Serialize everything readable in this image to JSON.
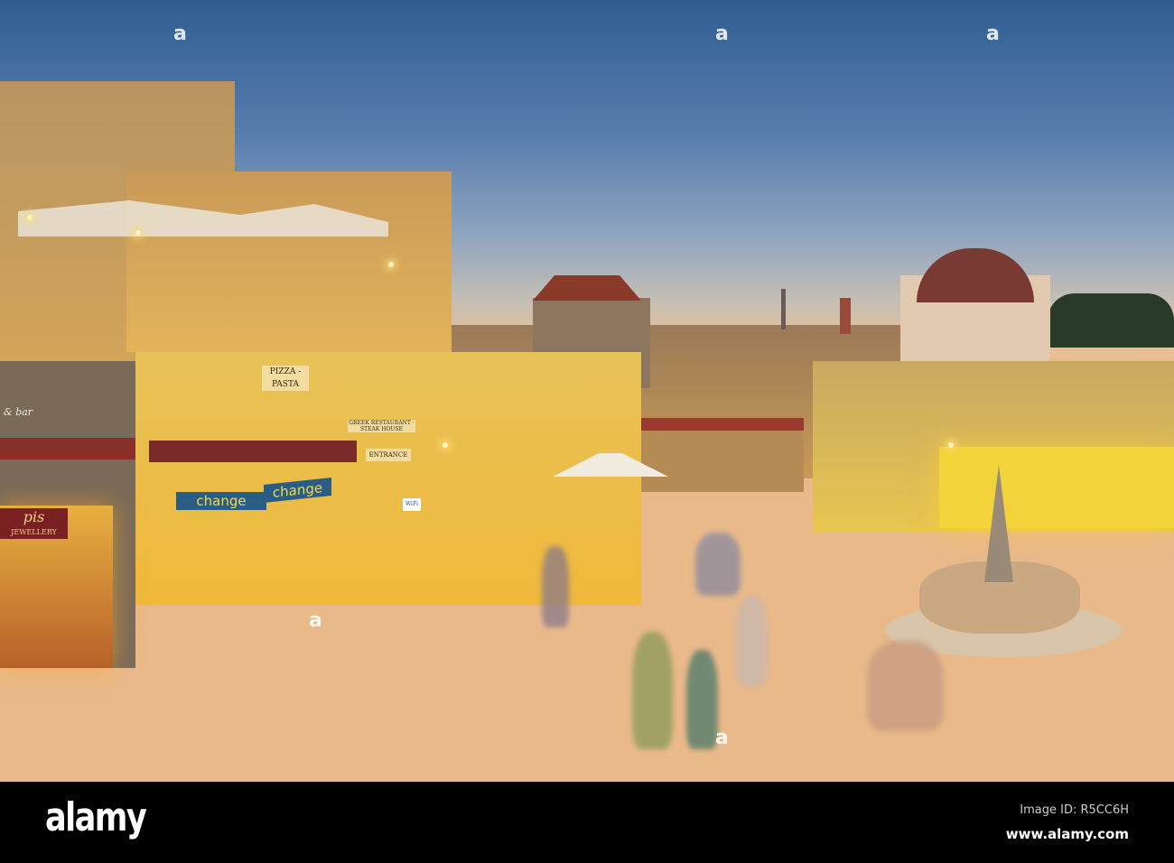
{
  "photo": {
    "signs": {
      "pizza": "PIZZA - PASTA",
      "change1": "change",
      "change2": "change",
      "jewellery": "JEWELLERY",
      "jewellery_brand": "pis",
      "bar": "& bar",
      "restaurant": "GREEK RESTAURANT · STEAK HOUSE",
      "entrance": "ENTRANCE",
      "wifi": "WiFi"
    },
    "watermark": "a"
  },
  "footer": {
    "logo": "alamy",
    "image_id": "Image ID: R5CC6H",
    "site": "www.alamy.com"
  }
}
